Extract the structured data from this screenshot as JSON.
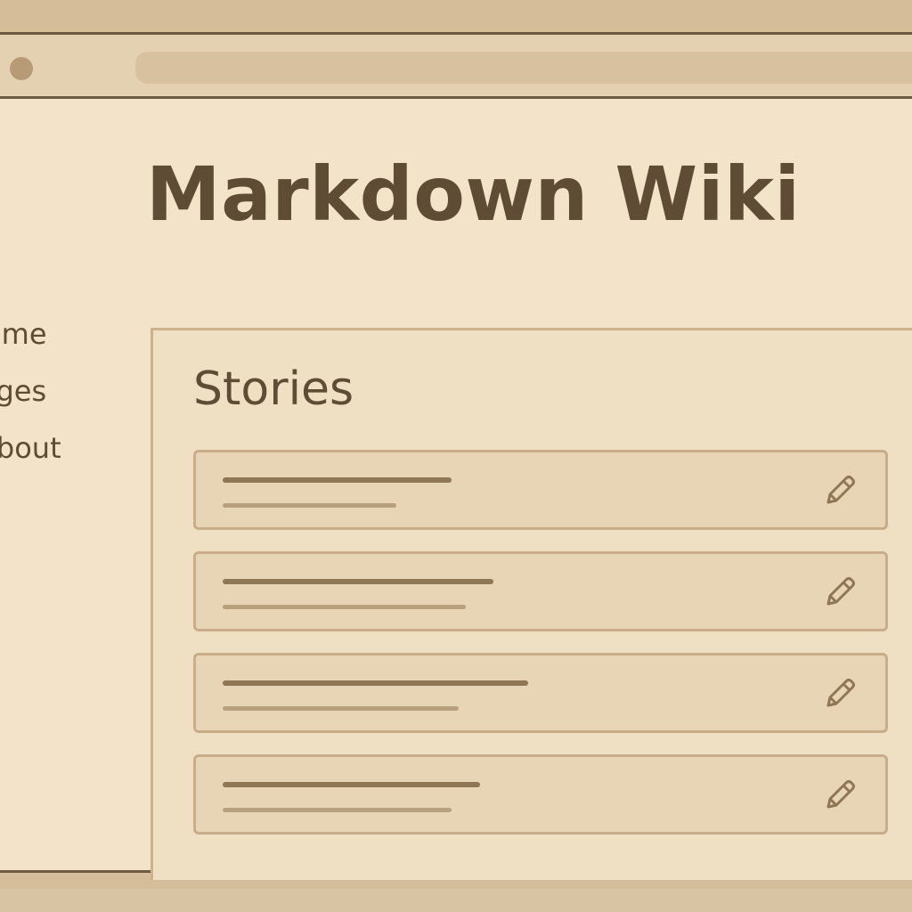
{
  "app": {
    "title": "Markdown Wiki"
  },
  "sidebar": {
    "items": [
      {
        "label": "Home"
      },
      {
        "label": "Pages"
      },
      {
        "label": "About"
      }
    ]
  },
  "main": {
    "section_title": "Stories",
    "stories": [
      {
        "title_placeholder_width": 0.33,
        "sub_placeholder_width": 0.25
      },
      {
        "title_placeholder_width": 0.39,
        "sub_placeholder_width": 0.35
      },
      {
        "title_placeholder_width": 0.44,
        "sub_placeholder_width": 0.34
      },
      {
        "title_placeholder_width": 0.37,
        "sub_placeholder_width": 0.33
      }
    ]
  },
  "icons": {
    "window_control": "circle-icon",
    "story_action": "pencil-icon"
  },
  "colors": {
    "background": "#f2e3c9",
    "text": "#5f4c35",
    "accent": "#8f7655",
    "border": "#c8ad88"
  }
}
